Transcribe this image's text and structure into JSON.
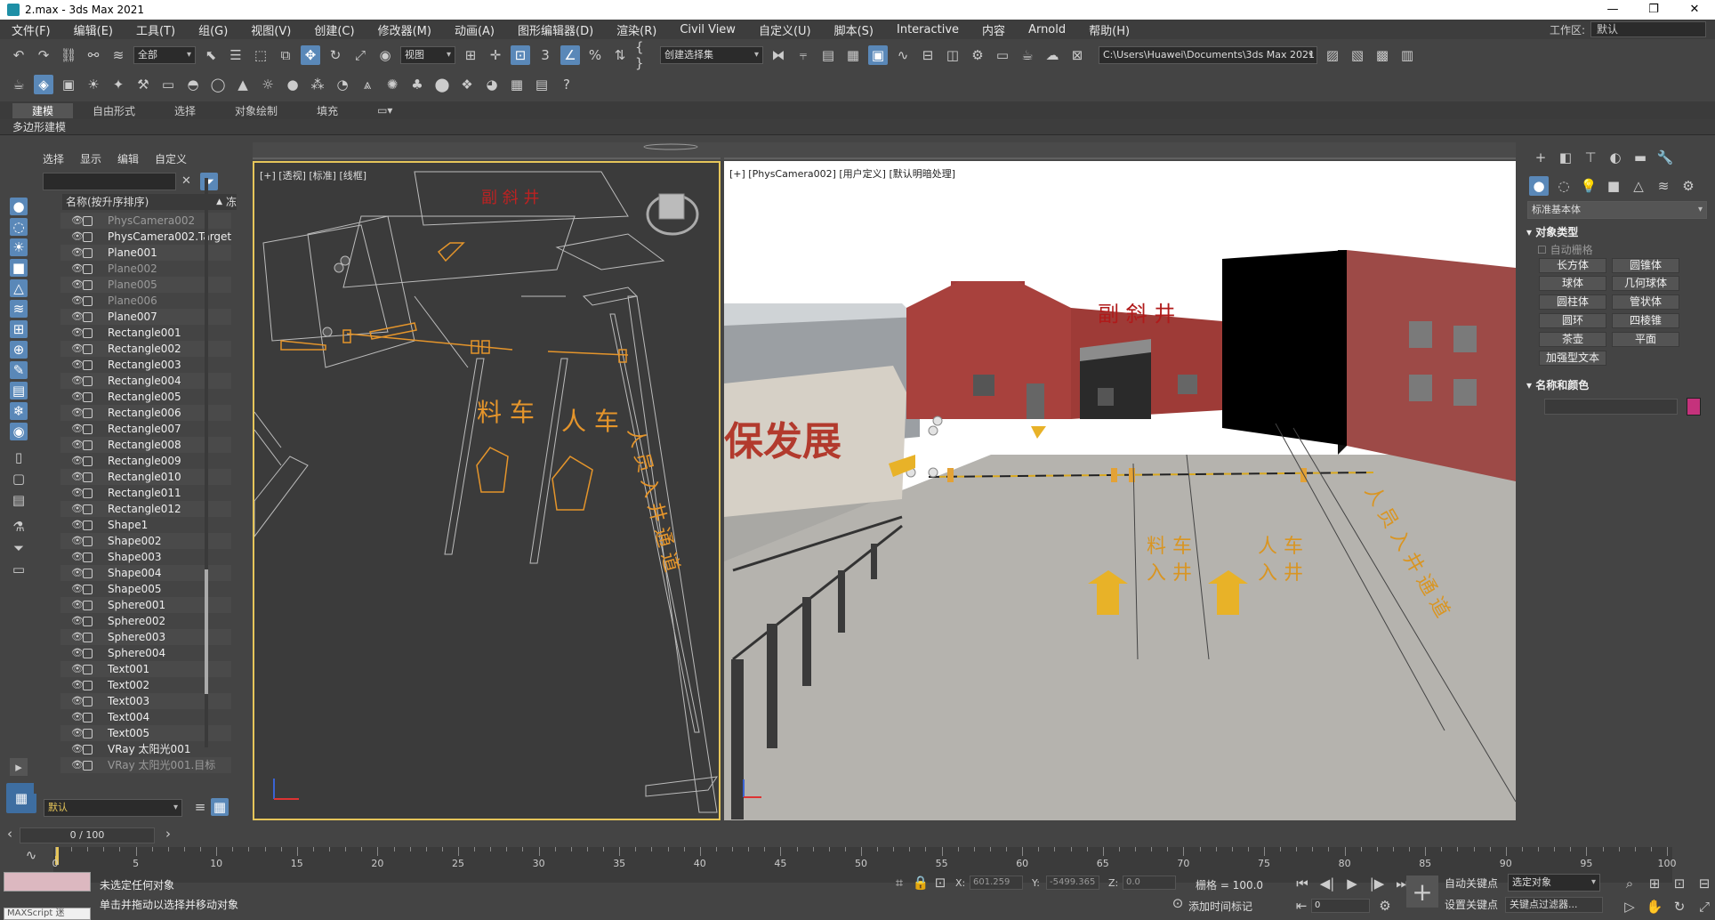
{
  "window": {
    "title": "2.max - 3ds Max 2021"
  },
  "menu": [
    "文件(F)",
    "编辑(E)",
    "工具(T)",
    "组(G)",
    "视图(V)",
    "创建(C)",
    "修改器(M)",
    "动画(A)",
    "图形编辑器(D)",
    "渲染(R)",
    "Civil View",
    "自定义(U)",
    "脚本(S)",
    "Interactive",
    "内容",
    "Arnold",
    "帮助(H)"
  ],
  "workspace": {
    "label": "工作区:",
    "value": "默认"
  },
  "toolbar": {
    "selection_filter": "全部",
    "ref_coord": "视图",
    "named_selection": "创建选择集",
    "path": "C:\\Users\\Huawei\\Documents\\3ds Max 2021"
  },
  "ribbon": {
    "tabs": [
      "建模",
      "自由形式",
      "选择",
      "对象绘制",
      "填充"
    ],
    "active": "建模",
    "subpanel": "多边形建模"
  },
  "scene_explorer": {
    "tabs": [
      "选择",
      "显示",
      "编辑",
      "自定义"
    ],
    "column_header": "名称(按升序排序)",
    "column_header_right": "冻",
    "items": [
      {
        "name": "PhysCamera002",
        "dim": true,
        "type": "camera"
      },
      {
        "name": "PhysCamera002.Target",
        "dim": false,
        "type": "camera"
      },
      {
        "name": "Plane001",
        "dim": false,
        "type": "geom"
      },
      {
        "name": "Plane002",
        "dim": true,
        "type": "geom"
      },
      {
        "name": "Plane005",
        "dim": true,
        "type": "geom"
      },
      {
        "name": "Plane006",
        "dim": true,
        "type": "geom"
      },
      {
        "name": "Plane007",
        "dim": false,
        "type": "geom"
      },
      {
        "name": "Rectangle001",
        "dim": false,
        "type": "shape"
      },
      {
        "name": "Rectangle002",
        "dim": false,
        "type": "shape"
      },
      {
        "name": "Rectangle003",
        "dim": false,
        "type": "shape"
      },
      {
        "name": "Rectangle004",
        "dim": false,
        "type": "shape"
      },
      {
        "name": "Rectangle005",
        "dim": false,
        "type": "shape"
      },
      {
        "name": "Rectangle006",
        "dim": false,
        "type": "shape"
      },
      {
        "name": "Rectangle007",
        "dim": false,
        "type": "shape"
      },
      {
        "name": "Rectangle008",
        "dim": false,
        "type": "shape"
      },
      {
        "name": "Rectangle009",
        "dim": false,
        "type": "shape"
      },
      {
        "name": "Rectangle010",
        "dim": false,
        "type": "shape"
      },
      {
        "name": "Rectangle011",
        "dim": false,
        "type": "shape"
      },
      {
        "name": "Rectangle012",
        "dim": false,
        "type": "shape"
      },
      {
        "name": "Shape1",
        "dim": false,
        "type": "shape"
      },
      {
        "name": "Shape002",
        "dim": false,
        "type": "shape"
      },
      {
        "name": "Shape003",
        "dim": false,
        "type": "shape"
      },
      {
        "name": "Shape004",
        "dim": false,
        "type": "shape"
      },
      {
        "name": "Shape005",
        "dim": false,
        "type": "shape"
      },
      {
        "name": "Sphere001",
        "dim": false,
        "type": "geom"
      },
      {
        "name": "Sphere002",
        "dim": false,
        "type": "geom"
      },
      {
        "name": "Sphere003",
        "dim": false,
        "type": "geom"
      },
      {
        "name": "Sphere004",
        "dim": false,
        "type": "geom"
      },
      {
        "name": "Text001",
        "dim": false,
        "type": "shape"
      },
      {
        "name": "Text002",
        "dim": false,
        "type": "shape"
      },
      {
        "name": "Text003",
        "dim": false,
        "type": "shape"
      },
      {
        "name": "Text004",
        "dim": false,
        "type": "shape"
      },
      {
        "name": "Text005",
        "dim": false,
        "type": "shape"
      },
      {
        "name": "VRay 太阳光001",
        "dim": false,
        "type": "light"
      },
      {
        "name": "VRay 太阳光001.目标",
        "dim": true,
        "type": "light"
      }
    ],
    "layer": "默认"
  },
  "viewport_left": {
    "label": "[+] [透视] [标准] [线框]",
    "sign_text": "副 斜 井"
  },
  "viewport_right": {
    "label": "[+] [PhysCamera002] [用户定义] [默认明暗处理]",
    "sign_text": "副 斜 井",
    "wall_text": "保发展"
  },
  "command_panel": {
    "category": "标准基本体",
    "rollout_object_type": "对象类型",
    "autogrid": "自动栅格",
    "buttons": [
      "长方体",
      "圆锥体",
      "球体",
      "几何球体",
      "圆柱体",
      "管状体",
      "圆环",
      "四棱锥",
      "茶壶",
      "平面",
      "加强型文本"
    ],
    "rollout_name_color": "名称和颜色",
    "object_color": "#c5327c"
  },
  "timeline": {
    "slider": "0 / 100",
    "ticks": [
      0,
      5,
      10,
      15,
      20,
      25,
      30,
      35,
      40,
      45,
      50,
      55,
      60,
      65,
      70,
      75,
      80,
      85,
      90,
      95,
      100
    ]
  },
  "status": {
    "selection": "未选定任何对象",
    "prompt": "单击并拖动以选择并移动对象",
    "maxscript": "MAXScript 迷",
    "x_label": "X:",
    "x": "601.259",
    "y_label": "Y:",
    "y": "-5499.365",
    "z_label": "Z:",
    "z": "0.0",
    "grid": "栅格 = 100.0",
    "add_time_tag": "添加时间标记",
    "auto_key": "自动关键点",
    "set_key": "设置关键点",
    "selected": "选定对象",
    "key_filters": "关键点过滤器...",
    "frame": "0"
  }
}
